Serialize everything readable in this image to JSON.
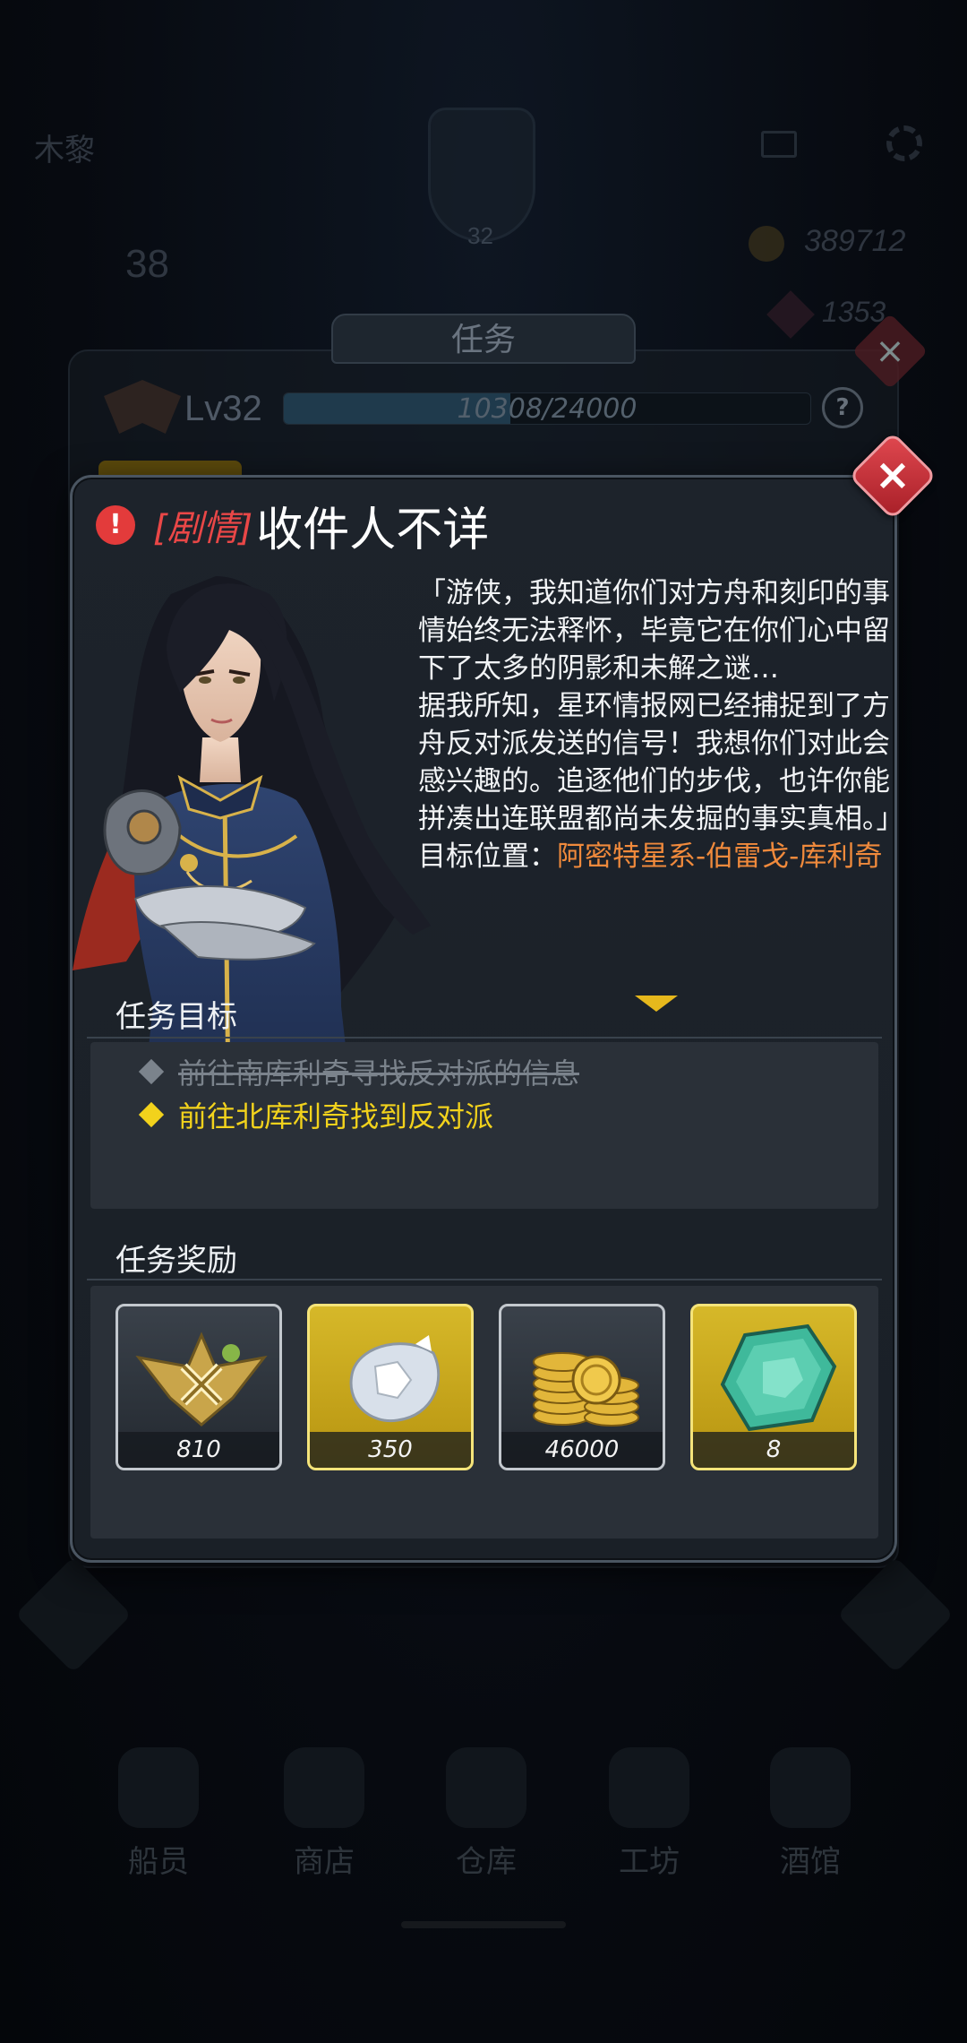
{
  "background": {
    "player_name": "木黎",
    "badge_level": "32",
    "stat_value": "38",
    "gold": "389712",
    "gems": "1353",
    "mission_tab_title": "任务",
    "level_label": "Lv32",
    "xp_text": "10308/24000",
    "xp_current": 10308,
    "xp_max": 24000,
    "help_label": "?",
    "nav": [
      "船员",
      "商店",
      "仓库",
      "工坊",
      "酒馆"
    ]
  },
  "dialog": {
    "close_label": "×",
    "alert_glyph": "!",
    "tag": "[剧情]",
    "title": "收件人不详",
    "story_lines": [
      "「游侠，我知道你们对方舟和刻印的事情始终无法释怀，毕竟它在你们心中留下了太多的阴影和未解之谜…",
      "据我所知，星环情报网已经捕捉到了方舟反对派发送的信号！我想你们对此会感兴趣的。追逐他们的步伐，也许你能拼凑出连联盟都尚未发掘的事实真相。」"
    ],
    "location_label": "目标位置：",
    "location_value": "阿密特星系-伯雷戈-库利奇",
    "goals_title": "任务目标",
    "goals": [
      {
        "text": "前往南库利奇寻找反对派的信息",
        "status": "done"
      },
      {
        "text": "前往北库利奇找到反对派",
        "status": "active"
      }
    ],
    "rewards_title": "任务奖励",
    "rewards": [
      {
        "icon": "rank-badge-icon",
        "amount": "810",
        "rarity": "normal"
      },
      {
        "icon": "crystal-ore-icon",
        "amount": "350",
        "rarity": "gold"
      },
      {
        "icon": "gold-coins-icon",
        "amount": "46000",
        "rarity": "normal"
      },
      {
        "icon": "green-gem-icon",
        "amount": "8",
        "rarity": "gold"
      }
    ]
  },
  "colors": {
    "accent_red": "#e94747",
    "location_orange": "#f08a3c",
    "goal_active": "#f2d21c",
    "goal_done": "#7b838c",
    "rare_gold": "#d6b829"
  }
}
